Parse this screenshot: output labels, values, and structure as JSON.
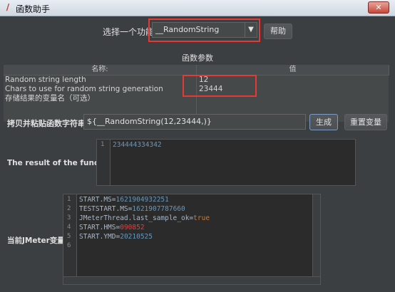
{
  "window": {
    "title": "函数助手",
    "close_glyph": "✕"
  },
  "function_selector": {
    "label": "选择一个功能",
    "selected": "__RandomString",
    "help_button": "帮助"
  },
  "params": {
    "title": "函数参数",
    "headers": [
      "名称:",
      "值"
    ],
    "rows": [
      {
        "name": "Random string length",
        "value": "12"
      },
      {
        "name": "Chars to use for random string generation",
        "value": "23444"
      },
      {
        "name": "存储结果的变量名（可选）",
        "value": ""
      }
    ]
  },
  "copy": {
    "label": "拷贝并粘贴函数字符串",
    "value": "${__RandomString(12,23444,)}",
    "generate_button": "生成",
    "reset_button": "重置变量"
  },
  "result": {
    "label": "The result of the function is",
    "lines": [
      {
        "num": "1",
        "text": "234444334342"
      }
    ]
  },
  "vars": {
    "label": "当前JMeter变量",
    "lines": [
      {
        "num": "1",
        "key": "START.MS",
        "value": "1621904932251",
        "kind": "number"
      },
      {
        "num": "2",
        "key": "TESTSTART.MS",
        "value": "1621907787660",
        "kind": "number"
      },
      {
        "num": "3",
        "key": "JMeterThread.last_sample_ok",
        "value": "true",
        "kind": "keyword"
      },
      {
        "num": "4",
        "key": "START.HMS",
        "value": "090852",
        "kind": "red"
      },
      {
        "num": "5",
        "key": "START.YMD",
        "value": "20210525",
        "kind": "number"
      },
      {
        "num": "6",
        "key": "",
        "value": "",
        "kind": "empty"
      }
    ]
  },
  "colors": {
    "background": "#3c3f41",
    "highlight": "#e53935",
    "number": "#6897bb",
    "keyword": "#cc7832",
    "red_value": "#e04040"
  }
}
